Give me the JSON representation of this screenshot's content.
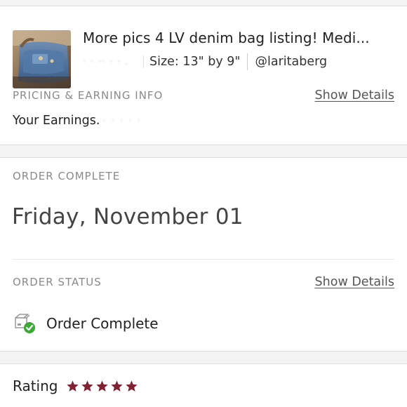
{
  "listing": {
    "title": "More pics 4 LV denim bag listing! Medi...",
    "price_redacted": "· · ·· · ·  .",
    "size": "Size: 13\" by 9\"",
    "seller": "@laritaberg"
  },
  "pricing": {
    "label": "PRICING & EARNING INFO",
    "show_details": "Show Details",
    "earnings_label": "Your Earnings.",
    "earnings_redacted": "· · · · ·"
  },
  "order_complete": {
    "label": "ORDER COMPLETE",
    "date": "Friday, November 01"
  },
  "order_status": {
    "label": "ORDER STATUS",
    "show_details": "Show Details",
    "status": "Order Complete",
    "status_icon": "package-check-icon",
    "check_color": "#3aaa35"
  },
  "rating": {
    "label": "Rating",
    "stars": 5,
    "max_stars": 5,
    "star_color": "#7f2232"
  }
}
